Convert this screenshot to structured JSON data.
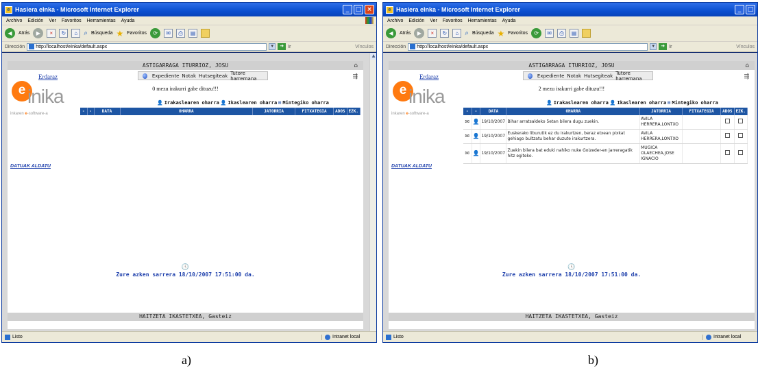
{
  "window_title": "Hasiera eInka - Microsoft Internet Explorer",
  "menu": [
    "Archivo",
    "Edición",
    "Ver",
    "Favoritos",
    "Herramientas",
    "Ayuda"
  ],
  "toolbar": {
    "back": "Atrás",
    "search": "Búsqueda",
    "favorites": "Favoritos"
  },
  "address": {
    "label": "Dirección",
    "url": "http://localhost/eInka/default.aspx",
    "go": "Ir",
    "links": "Vínculos"
  },
  "app": {
    "user_name": "ASTIGARRAGA ITURRIOZ, JOSU",
    "erdaraz": "Erdaraz",
    "tabs": [
      "Expediente",
      "Notak",
      "Hutsegiteak",
      "Tutore harremana"
    ],
    "logo_letter": "e",
    "logo_word": "inika",
    "logo_tag_pre": "inkaren ",
    "logo_tag_e": "e",
    "logo_tag_post": "-software-a",
    "datuak": "DATUAK ALDATU",
    "legend": [
      "Irakaslearen oharra",
      "Ikaslearen oharra",
      "Mintegiko oharra"
    ],
    "columns": [
      "-",
      "-",
      "DATA",
      "OHARRA",
      "JATORRIA",
      "FITXATEGIA",
      "ADOS",
      "EZK."
    ],
    "last_login": "Zure azken sarrera 18/10/2007 17:51:00 da.",
    "footer": "HAITZETA IKASTETXEA, Gasteiz"
  },
  "panel_a": {
    "unread_msg": "0 mezu irakurri gabe dituzu!!!"
  },
  "panel_b": {
    "unread_msg": "2 mezu irakurri gabe dituzu!!!",
    "rows": [
      {
        "date": "19/10/2007",
        "note": "Bihar arratsaldeko 5etan bilera dugu zuekin.",
        "source": "AVILA HERRERA,LONTXO"
      },
      {
        "date": "19/10/2007",
        "note": "Euskerako liburutik ez du irakurtzen, beraz etxean pixkat gehiago bultzatu behar duzute irakurtzera.",
        "source": "AVILA HERRERA,LONTXO"
      },
      {
        "date": "19/10/2007",
        "note": "Zuekin bilera bat eduki nahiko nuke Goizeder-en jarreragatik hitz egiteko.",
        "source": "MUGICA OLAECHEA,JOSE IGNACIO"
      }
    ]
  },
  "status": {
    "text": "Listo",
    "zone": "Intranet local"
  },
  "captions": [
    "a)",
    "b)"
  ]
}
